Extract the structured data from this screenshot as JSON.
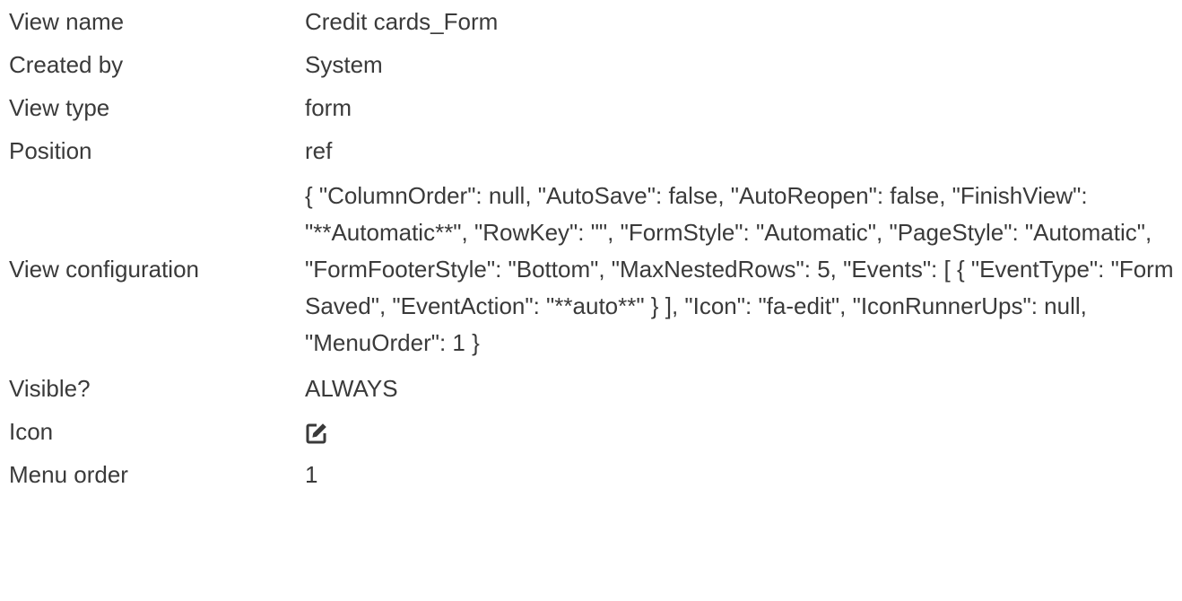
{
  "rows": [
    {
      "label": "View name",
      "value": "Credit cards_Form"
    },
    {
      "label": "Created by",
      "value": "System"
    },
    {
      "label": "View type",
      "value": "form"
    },
    {
      "label": "Position",
      "value": "ref"
    },
    {
      "label": "View configuration",
      "value": "{ \"ColumnOrder\": null, \"AutoSave\": false, \"AutoReopen\": false, \"FinishView\": \"**Automatic**\", \"RowKey\": \"\", \"FormStyle\": \"Automatic\", \"PageStyle\": \"Automatic\", \"FormFooterStyle\": \"Bottom\", \"MaxNestedRows\": 5, \"Events\": [ { \"EventType\": \"Form Saved\", \"EventAction\": \"**auto**\" } ], \"Icon\": \"fa-edit\", \"IconRunnerUps\": null, \"MenuOrder\": 1 }"
    },
    {
      "label": "Visible?",
      "value": "ALWAYS"
    },
    {
      "label": "Icon",
      "icon": "edit-icon"
    },
    {
      "label": "Menu order",
      "value": "1"
    }
  ],
  "colors": {
    "text": "#3a3a3a",
    "background": "#ffffff"
  }
}
